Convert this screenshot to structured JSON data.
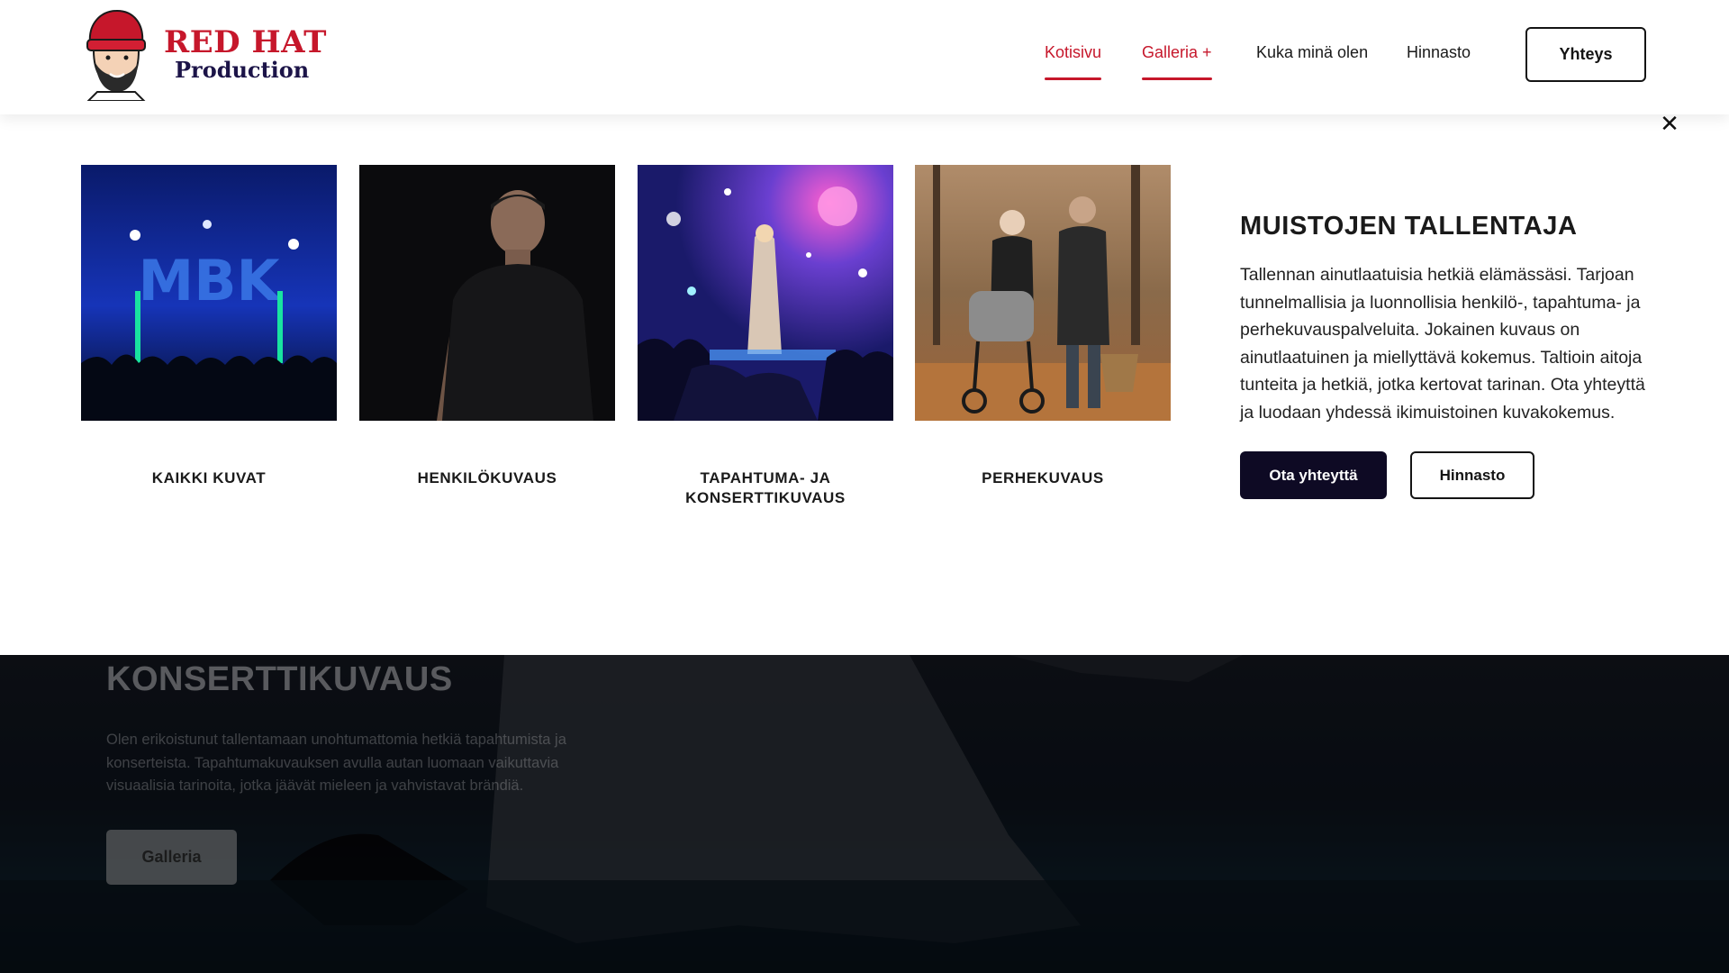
{
  "brand": {
    "line1": "RED HAT",
    "line2": "Production",
    "colors": {
      "red": "#c6172b",
      "navy": "#1c1448"
    }
  },
  "nav": {
    "items": [
      {
        "label": "Kotisivu",
        "active": true
      },
      {
        "label": "Galleria +",
        "active": true
      },
      {
        "label": "Kuka minä olen",
        "active": false
      },
      {
        "label": "Hinnasto",
        "active": false
      }
    ],
    "cta_label": "Yhteys"
  },
  "mega_menu": {
    "close_icon": "close-icon",
    "cards": [
      {
        "label": "KAIKKI KUVAT",
        "image": "concert-stage-photo"
      },
      {
        "label": "HENKILÖKUVAUS",
        "image": "portrait-man-photo"
      },
      {
        "label": "TAPAHTUMA- JA KONSERTTIKUVAUS",
        "image": "singer-on-stage-photo"
      },
      {
        "label": "PERHEKUVAUS",
        "image": "family-walk-photo"
      }
    ],
    "promo": {
      "title": "MUISTOJEN TALLENTAJA",
      "text": "Tallennan ainutlaatuisia hetkiä elämässäsi. Tarjoan tunnelmallisia ja luonnollisia henkilö-, tapahtuma- ja perhekuvauspalveluita. Jokainen kuvaus on ainutlaatuinen ja miellyttävä kokemus. Taltioin aitoja tunteita ja hetkiä, jotka kertovat tarinan. Ota yhteyttä ja luodaan yhdessä ikimuistoinen kuvakokemus.",
      "primary_label": "Ota yhteyttä",
      "secondary_label": "Hinnasto"
    }
  },
  "hero": {
    "title": "KONSERTTIKUVAUS",
    "text": "Olen erikoistunut tallentamaan unohtumattomia hetkiä tapahtumista ja konserteista. Tapahtumakuvauksen avulla autan luomaan vaikuttavia visuaalisia tarinoita, jotka jäävät mieleen ja vahvistavat brändiä.",
    "button_label": "Galleria"
  },
  "colors": {
    "accent": "#c6172b",
    "dark_button": "#0e0a24"
  }
}
